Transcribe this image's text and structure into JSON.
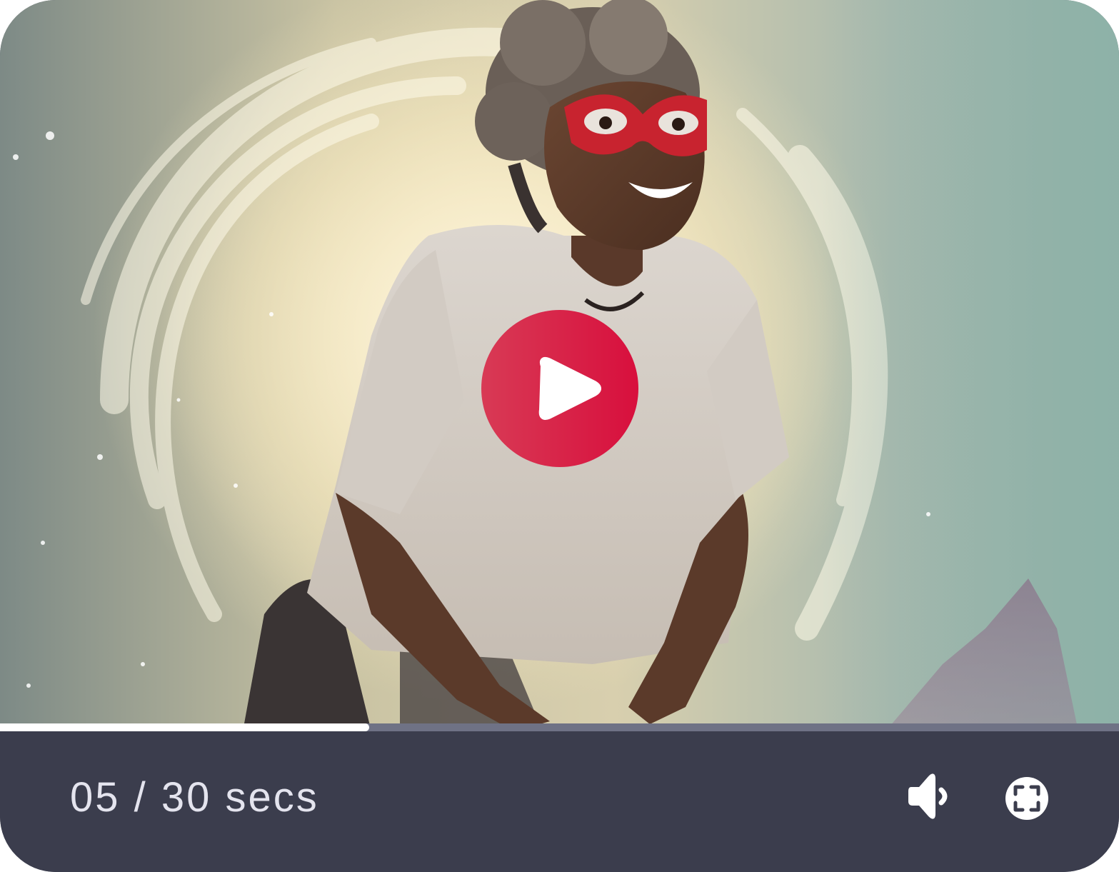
{
  "player": {
    "time_label": "05 / 30 secs",
    "current_seconds": 5,
    "total_seconds": 30,
    "progress_fraction": 0.33,
    "icons": {
      "play": "play-icon",
      "volume": "volume-icon",
      "fullscreen": "fullscreen-icon"
    },
    "colors": {
      "play_button": "#d8173f",
      "control_bar": "#3b3d4d",
      "progress_fill": "#ffffff",
      "progress_track": "#6f7285",
      "text": "#e4e4ee"
    }
  }
}
